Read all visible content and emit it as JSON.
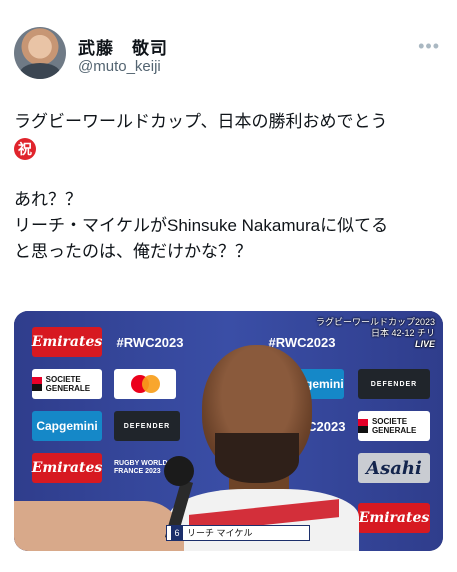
{
  "user": {
    "display_name": "武藤　敬司",
    "handle": "@muto_keiji",
    "avatar_icon": "profile-photo",
    "more_icon": "more-dots-icon",
    "more_glyph": "•••"
  },
  "tweet": {
    "line1": "ラグビーワールドカップ、日本の勝利おめでとう",
    "emoji": "祝",
    "line2": "あれ？？",
    "line3": "リーチ・マイケルがShinsuke Nakamuraに似てる",
    "line4": "と思ったのは、俺だけかな？？"
  },
  "media": {
    "logos": {
      "emirates": "Emirates",
      "rwc": "#RWC2023",
      "socgen": "SOCIETE GENERALE",
      "capgemini": "Capgemini",
      "defender": "DEFENDER",
      "asahi": "Asahi",
      "rugby_world": "RUGBY WORLD FRANCE 2023"
    },
    "broadcast_overlay": {
      "title": "ラグビーワールドカップ2023",
      "score": "日本 42-12 チリ",
      "live": "LIVE"
    },
    "caption": {
      "number": "6",
      "name": "リーチ マイケル"
    }
  },
  "colors": {
    "emirates_red": "#d71921",
    "wall_blue": "#3a4ea6",
    "iwai_red": "#e0242c",
    "handle_gray": "#536471"
  }
}
